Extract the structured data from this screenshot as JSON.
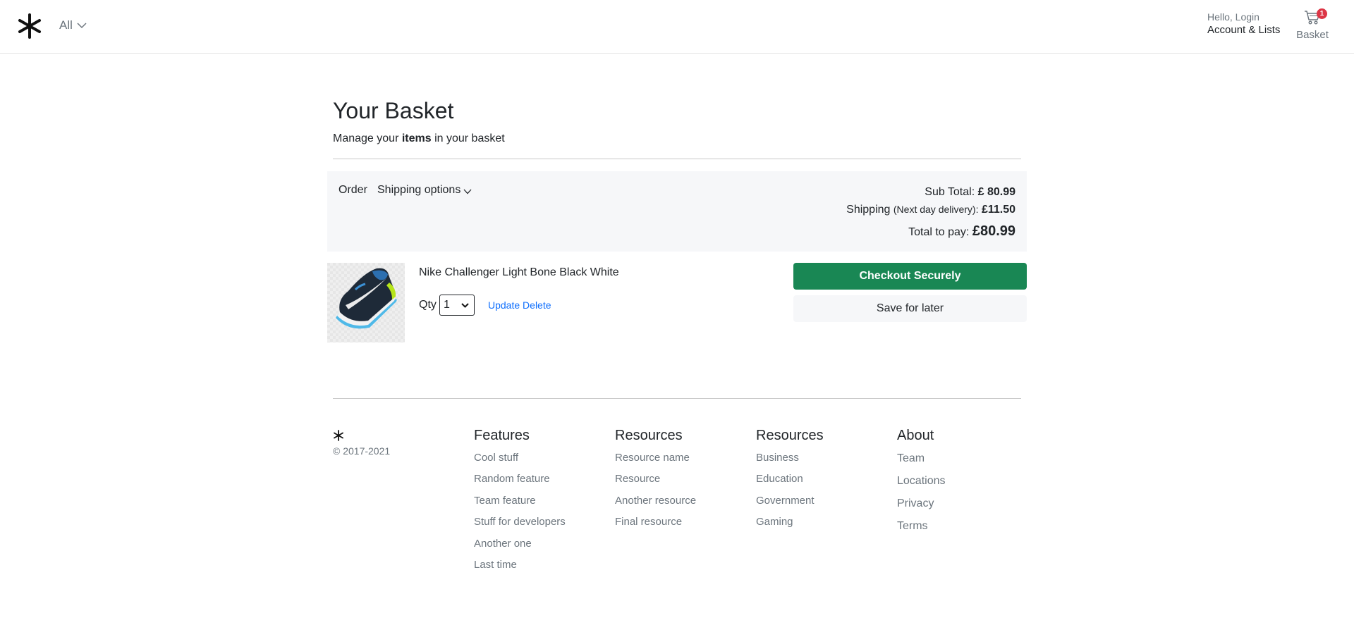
{
  "header": {
    "category_label": "All",
    "account_greeting": "Hello, Login",
    "account_lists": "Account & Lists",
    "basket_label": "Basket",
    "basket_count": "1"
  },
  "basket": {
    "title": "Your Basket",
    "subtitle_before": "Manage your ",
    "subtitle_bold": "items",
    "subtitle_after": " in your basket",
    "order_label": "Order",
    "shipping_options_label": "Shipping options",
    "subtotal_label": "Sub Total:",
    "subtotal_value": "£ 80.99",
    "shipping_label": "Shipping",
    "shipping_note": "(Next day delivery):",
    "shipping_value": "£11.50",
    "total_label": "Total to pay:",
    "total_value": "£80.99"
  },
  "item": {
    "name": "Nike Challenger Light Bone Black White",
    "qty_label": "Qty",
    "qty_value": "1",
    "update_label": "Update",
    "delete_label": "Delete",
    "image_alt": "running shoe"
  },
  "actions": {
    "checkout_label": "Checkout Securely",
    "save_label": "Save for later"
  },
  "footer": {
    "copyright": "© 2017-2021",
    "columns": [
      {
        "title": "Features",
        "links": [
          "Cool stuff",
          "Random feature",
          "Team feature",
          "Stuff for developers",
          "Another one",
          "Last time"
        ]
      },
      {
        "title": "Resources",
        "links": [
          "Resource name",
          "Resource",
          "Another resource",
          "Final resource"
        ]
      },
      {
        "title": "Resources",
        "links": [
          "Business",
          "Education",
          "Government",
          "Gaming"
        ]
      },
      {
        "title": "About",
        "links": [
          "Team",
          "Locations",
          "Privacy",
          "Terms"
        ]
      }
    ]
  },
  "colors": {
    "checkout_green": "#198754",
    "link_blue": "#0d6efd",
    "badge_red": "#dc3545",
    "panel_bg": "#f6f7f9"
  }
}
